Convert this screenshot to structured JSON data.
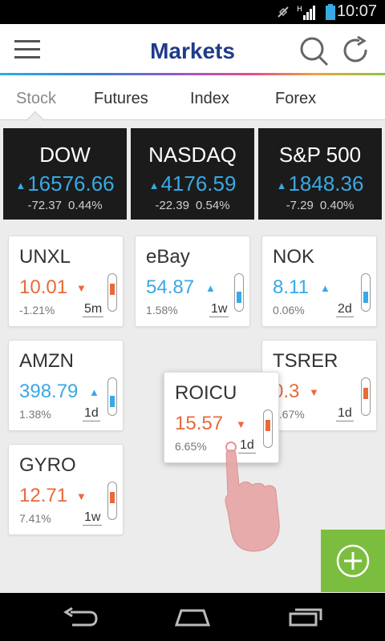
{
  "status_bar": {
    "time": "10:07",
    "icons": [
      "signal-muted-icon",
      "h-network-icon",
      "battery-icon"
    ]
  },
  "header": {
    "title": "Markets",
    "icons": [
      "menu-icon",
      "search-icon",
      "refresh-icon"
    ]
  },
  "tabs": [
    {
      "label": "Stock",
      "active": true
    },
    {
      "label": "Futures",
      "active": false
    },
    {
      "label": "Index",
      "active": false
    },
    {
      "label": "Forex",
      "active": false
    }
  ],
  "indices": [
    {
      "name": "DOW",
      "value": "16576.66",
      "change": "-72.37",
      "percent": "0.44%"
    },
    {
      "name": "NASDAQ",
      "value": "4176.59",
      "change": "-22.39",
      "percent": "0.54%"
    },
    {
      "name": "S&P 500",
      "value": "1848.36",
      "change": "-7.29",
      "percent": "0.40%"
    }
  ],
  "stocks": [
    {
      "symbol": "UNXL",
      "price": "10.01",
      "percent": "-1.21%",
      "period": "5m",
      "direction": "down"
    },
    {
      "symbol": "eBay",
      "price": "54.87",
      "percent": "1.58%",
      "period": "1w",
      "direction": "up"
    },
    {
      "symbol": "NOK",
      "price": "8.11",
      "percent": "0.06%",
      "period": "2d",
      "direction": "up"
    },
    {
      "symbol": "AMZN",
      "price": "398.79",
      "percent": "1.38%",
      "period": "1d",
      "direction": "up"
    },
    {
      "symbol": "TSRER",
      "price": "0.3",
      "percent": "4.67%",
      "period": "1d",
      "direction": "down"
    },
    {
      "symbol": "GYRO",
      "price": "12.71",
      "percent": "7.41%",
      "period": "1w",
      "direction": "down"
    },
    {
      "symbol": "ROICU",
      "price": "15.57",
      "percent": "6.65%",
      "period": "1d",
      "direction": "down"
    }
  ],
  "arrows": {
    "up": "▲",
    "down": "▼"
  },
  "colors": {
    "up": "#3aa8e6",
    "down": "#e86a3a",
    "accent": "#1f3b8a",
    "fab": "#7bbd3e"
  }
}
